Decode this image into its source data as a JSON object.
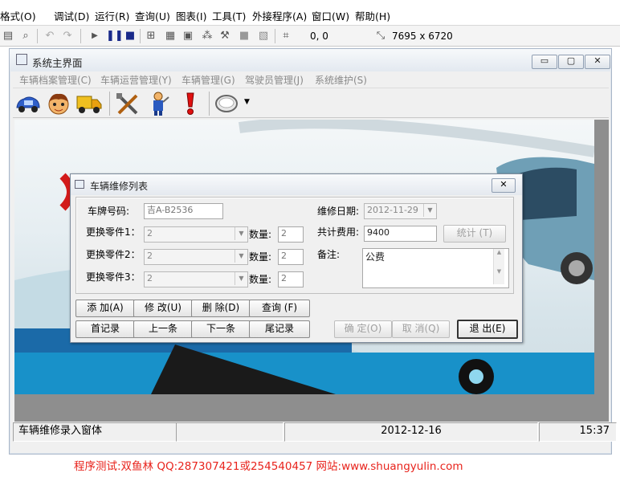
{
  "ide": {
    "menu": [
      "格式(O)",
      "调试(D)",
      "运行(R)",
      "查询(U)",
      "图表(I)",
      "工具(T)",
      "外接程序(A)",
      "窗口(W)",
      "帮助(H)"
    ],
    "toolbar": {
      "coords": "0, 0",
      "size": "7695 x 6720"
    }
  },
  "app": {
    "title": "系统主界面",
    "window_buttons": {
      "minimize": "▭",
      "maximize": "▢",
      "close": "✕"
    },
    "menu": [
      "车辆档案管理(C)",
      "车辆运营管理(Y)",
      "车辆管理(G)",
      "驾驶员管理(J)",
      "系统维护(S)"
    ],
    "toolbar_icons": [
      "car-icon",
      "driver-icon",
      "truck-icon",
      "tools-icon",
      "mechanic-icon",
      "alert-icon",
      "search-magnifier-icon"
    ],
    "statusbar": {
      "form_name": "车辆维修录入窗体",
      "panel2": "",
      "date": "2012-12-16",
      "time": "15:37"
    }
  },
  "dialog": {
    "title": "车辆维修列表",
    "close": "✕",
    "plate_label": "车牌号码:",
    "plate_value": "吉A-B2536",
    "date_label": "维修日期:",
    "date_value": "2012-11-29",
    "parts": [
      {
        "label": "更换零件1：",
        "value": "2",
        "qty_label": "数量:",
        "qty": "2"
      },
      {
        "label": "更换零件2：",
        "value": "2",
        "qty_label": "数量:",
        "qty": "2"
      },
      {
        "label": "更换零件3：",
        "value": "2",
        "qty_label": "数量:",
        "qty": "2"
      }
    ],
    "cost_label": "共计费用:",
    "cost_value": "9400",
    "stat_button": "统计 (T)",
    "note_label": "备注:",
    "note_value": "公费",
    "buttons_row1": [
      "添 加(A)",
      "修 改(U)",
      "删 除(D)",
      "查询 (F)"
    ],
    "buttons_row2": [
      "首记录",
      "上一条",
      "下一条",
      "尾记录"
    ],
    "confirm": "确 定(O)",
    "cancel": "取 消(Q)",
    "exit": "退 出(E)"
  },
  "footer": "程序测试:双鱼林 QQ:287307421或254540457 网站:www.shuangyulin.com"
}
